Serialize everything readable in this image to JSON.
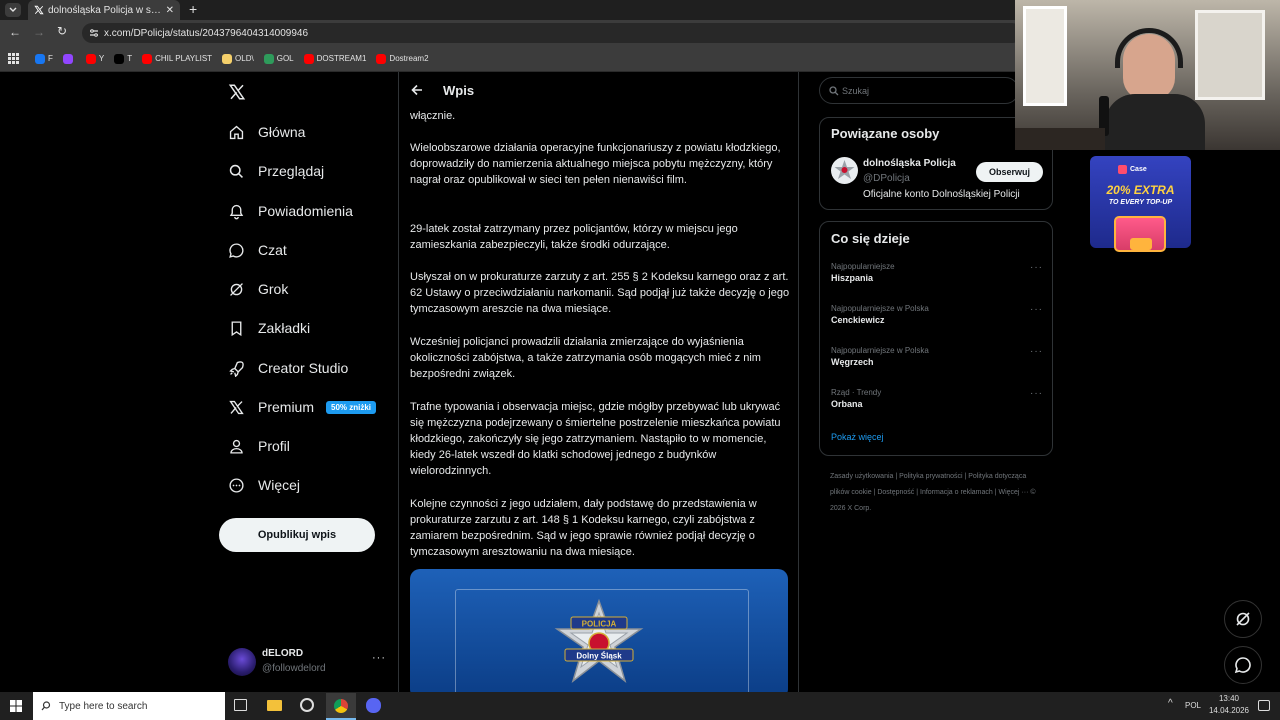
{
  "browser": {
    "tab_title": "dolnośląska Policja w serwisie X",
    "url": "x.com/DPolicja/status/2043796404314009946",
    "bookmarks": [
      {
        "label": "F",
        "color": "#1877f2"
      },
      {
        "label": "",
        "color": "#9146ff"
      },
      {
        "label": "Y",
        "color": "#ff0000"
      },
      {
        "label": "T",
        "color": "#000000"
      },
      {
        "label": "CHIL PLAYLIST",
        "color": "#ff0000"
      },
      {
        "label": "OLD\\",
        "color": "#f5d06b"
      },
      {
        "label": "GOL",
        "color": "#2e9b5b"
      },
      {
        "label": "DOSTREAM1",
        "color": "#ff0000"
      },
      {
        "label": "Dostream2",
        "color": "#ff0000"
      }
    ]
  },
  "sidebar": {
    "items": [
      {
        "label": "Główna",
        "icon": "home-icon"
      },
      {
        "label": "Przeglądaj",
        "icon": "search-icon"
      },
      {
        "label": "Powiadomienia",
        "icon": "bell-icon"
      },
      {
        "label": "Czat",
        "icon": "chat-icon"
      },
      {
        "label": "Grok",
        "icon": "grok-icon"
      },
      {
        "label": "Zakładki",
        "icon": "bookmark-icon"
      },
      {
        "label": "Creator Studio",
        "icon": "rocket-icon"
      },
      {
        "label": "Premium",
        "icon": "x-logo-icon"
      },
      {
        "label": "Profil",
        "icon": "profile-icon"
      },
      {
        "label": "Więcej",
        "icon": "more-icon"
      }
    ],
    "premium_badge": "50% zniżki",
    "publish_label": "Opublikuj wpis",
    "account": {
      "name": "dELORD",
      "handle": "@followdelord"
    }
  },
  "post": {
    "header_title": "Wpis",
    "paragraphs": [
      "włącznie.",
      "Wieloobszarowe działania operacyjne funkcjonariuszy z powiatu kłodzkiego, doprowadziły do namierzenia aktualnego miejsca pobytu mężczyzny, który nagrał oraz  opublikował w sieci ten pełen nienawiści film.",
      "29-latek został zatrzymany przez policjantów, którzy w miejscu jego zamieszkania zabezpieczyli, także środki odurzające.",
      "Usłyszał on w prokuraturze zarzuty z art. 255  § 2 Kodeksu karnego oraz z art. 62 Ustawy o przeciwdziałaniu narkomanii. Sąd podjął już także decyzję o jego tymczasowym areszcie na dwa miesiące.",
      "Wcześniej policjanci prowadzili działania zmierzające do wyjaśnienia okoliczności zabójstwa, a także zatrzymania osób mogących mieć z nim bezpośredni związek.",
      "Trafne typowania i obserwacja miejsc, gdzie mógłby przebywać lub ukrywać się mężczyzna podejrzewany o śmiertelne postrzelenie mieszkańca powiatu kłodzkiego, zakończyły się jego zatrzymaniem. Nastąpiło to w momencie, kiedy 26-latek wszedł do klatki schodowej jednego z budynków wielorodzinnych.",
      "Kolejne czynności z jego udziałem, dały podstawę do przedstawienia w prokuraturze zarzutu z art. 148 § 1 Kodeksu karnego, czyli zabójstwa z zamiarem bezpośrednim. Sąd w jego sprawie również podjął decyzję o tymczasowym aresztowaniu na dwa miesiące."
    ],
    "badge_top": "POLICJA",
    "badge_bottom": "Dolny Śląsk"
  },
  "right": {
    "search_placeholder": "Szukaj",
    "related_title": "Powiązane osoby",
    "related_person": {
      "name": "dolnośląska Policja",
      "handle": "@DPolicja",
      "bio": "Oficjalne konto Dolnośląskiej Policji",
      "follow_label": "Obserwuj"
    },
    "trending_title": "Co się dzieje",
    "trends": [
      {
        "meta": "Najpopularniejsze",
        "name": "Hiszpania"
      },
      {
        "meta": "Najpopularniejsze w Polska",
        "name": "Cenckiewicz"
      },
      {
        "meta": "Najpopularniejsze w Polska",
        "name": "Węgrzech"
      },
      {
        "meta": "Rząd · Trendy",
        "name": "Orbana"
      }
    ],
    "show_more": "Pokaż więcej",
    "footer": "Zasady użytkowania   |   Polityka prywatności   |   Polityka dotycząca plików cookie   |   Dostępność   |   Informacja o reklamach   |   Więcej ···   © 2026 X Corp."
  },
  "overlay": {
    "ad_brand": "Case",
    "ad_line1": "20% EXTRA",
    "ad_line2": "TO EVERY TOP-UP"
  },
  "taskbar": {
    "search_placeholder": "Type here to search",
    "lang": "POL",
    "time": "13:40",
    "date": "14.04.2026"
  }
}
